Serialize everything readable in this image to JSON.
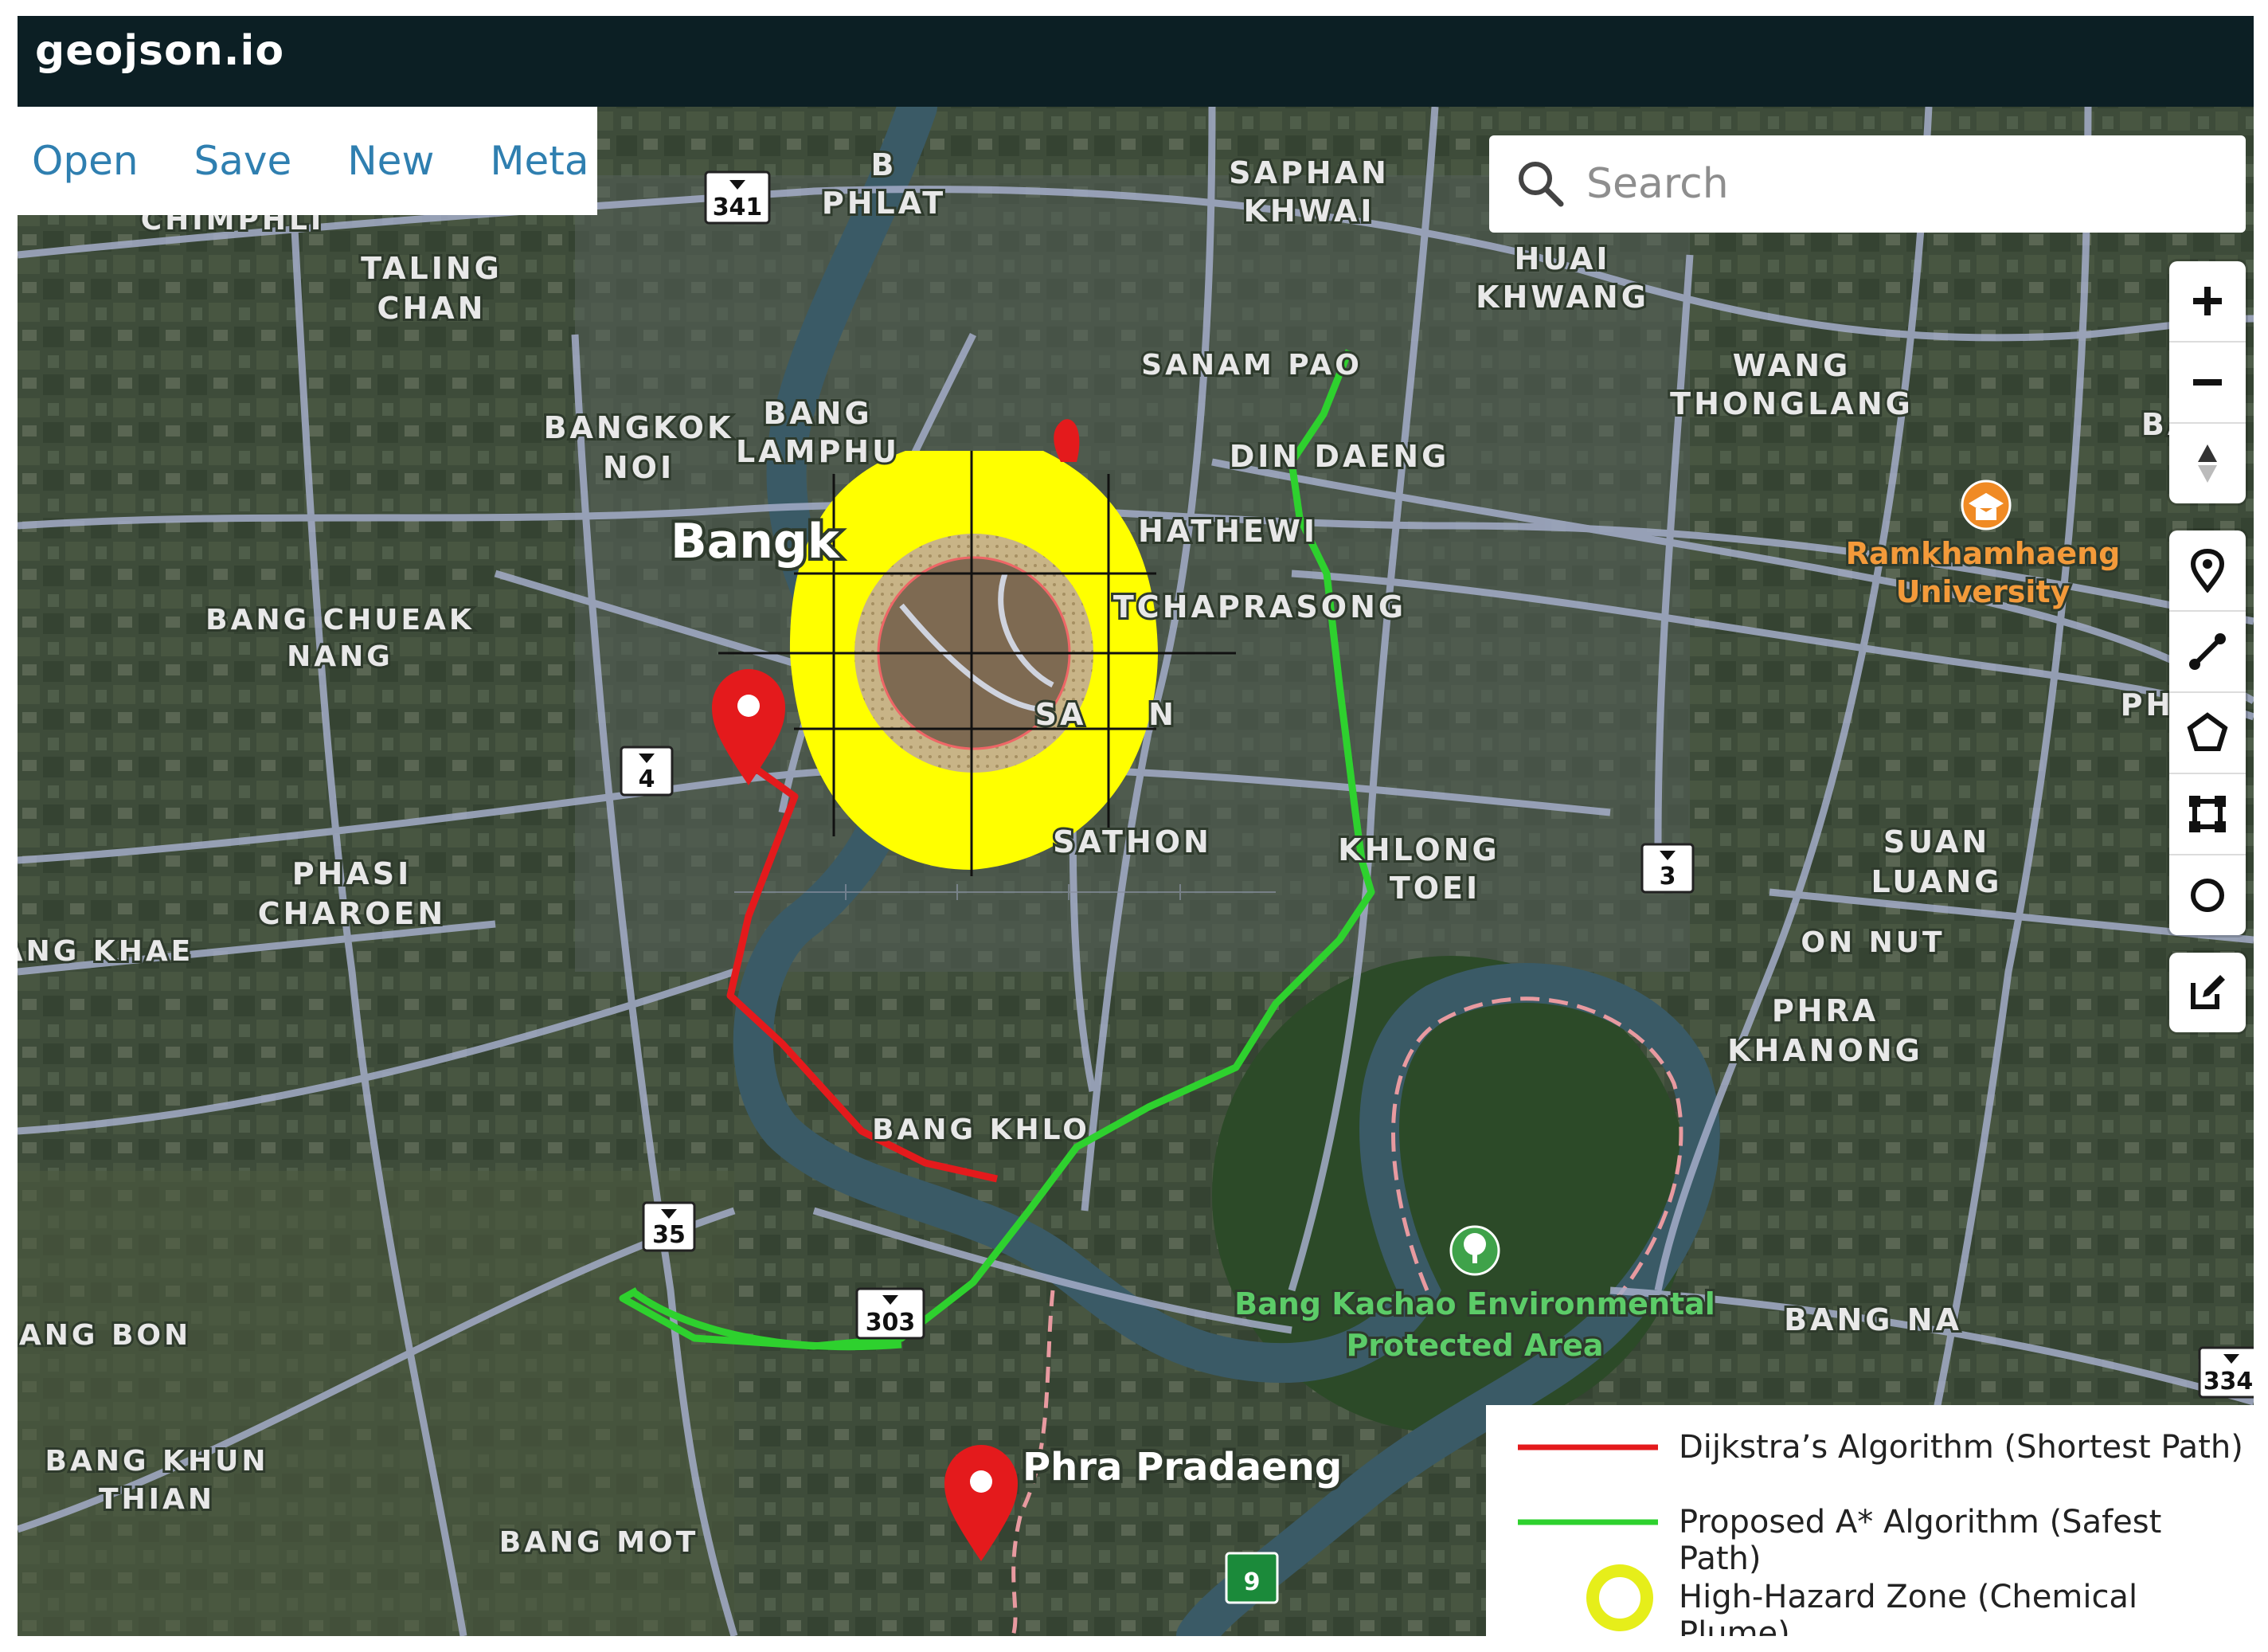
{
  "app": {
    "title": "geojson.io"
  },
  "menu": {
    "items": [
      "Open",
      "Save",
      "New",
      "Meta"
    ]
  },
  "search": {
    "placeholder": "Search"
  },
  "controls": {
    "zoom_in": "+",
    "zoom_out": "−",
    "compass": "compass-icon",
    "draw_tools": [
      "marker-icon",
      "line-icon",
      "polygon-icon",
      "rectangle-icon",
      "circle-icon"
    ],
    "edit": "edit-icon"
  },
  "map": {
    "areas": [
      "BANG PHLAT",
      "SAPHAN KHWAI",
      "CHIMPHLI",
      "TALING CHAN",
      "HUAI KHWANG",
      "SANAM PAO",
      "WANG THONGLANG",
      "BANGKOK NOI",
      "BANG LAMPHU",
      "DIN DAENG",
      "BANG CHUEAK NANG",
      "HATHEWI",
      "TCHAPRASONG",
      "SA",
      "N",
      "SATHON",
      "KHLONG TOEI",
      "PHASI CHAROEN",
      "ANG KHAE",
      "ON NUT",
      "SUAN LUANG",
      "PHRA KHANONG",
      "BANG KHLO",
      "BANG NA",
      "ANG BON",
      "BANG KHUN THIAN",
      "BANG MOT",
      "PHATT",
      "BA"
    ],
    "city_label": "Bangk",
    "district_label": "Phra Pradaeng",
    "poi": [
      {
        "name": "Ramkhamhaeng University",
        "icon": "university-icon"
      },
      {
        "name": "Bang Kachao Environmental Protected Area",
        "icon": "park-icon"
      }
    ],
    "route_shields": [
      "341",
      "4",
      "35",
      "303",
      "3",
      "334",
      "9"
    ],
    "markers": 3
  },
  "legend": [
    {
      "label": "Dijkstra’s Algorithm (Shortest Path)",
      "color": "#e41a1c",
      "kind": "line"
    },
    {
      "label": "Proposed A* Algorithm (Safest Path)",
      "color": "#2ed12e",
      "kind": "line"
    },
    {
      "label": "High-Hazard Zone (Chemical Plume)",
      "color": "#e6ee1a",
      "kind": "ring"
    }
  ],
  "colors": {
    "topbar": "#0c1f24",
    "menu_link": "#2f7fb0",
    "shortest_path": "#e41a1c",
    "safest_path": "#2ed12e",
    "hazard_outer": "#ffff00",
    "road": "#a4adc9",
    "river": "#3a5a66"
  }
}
